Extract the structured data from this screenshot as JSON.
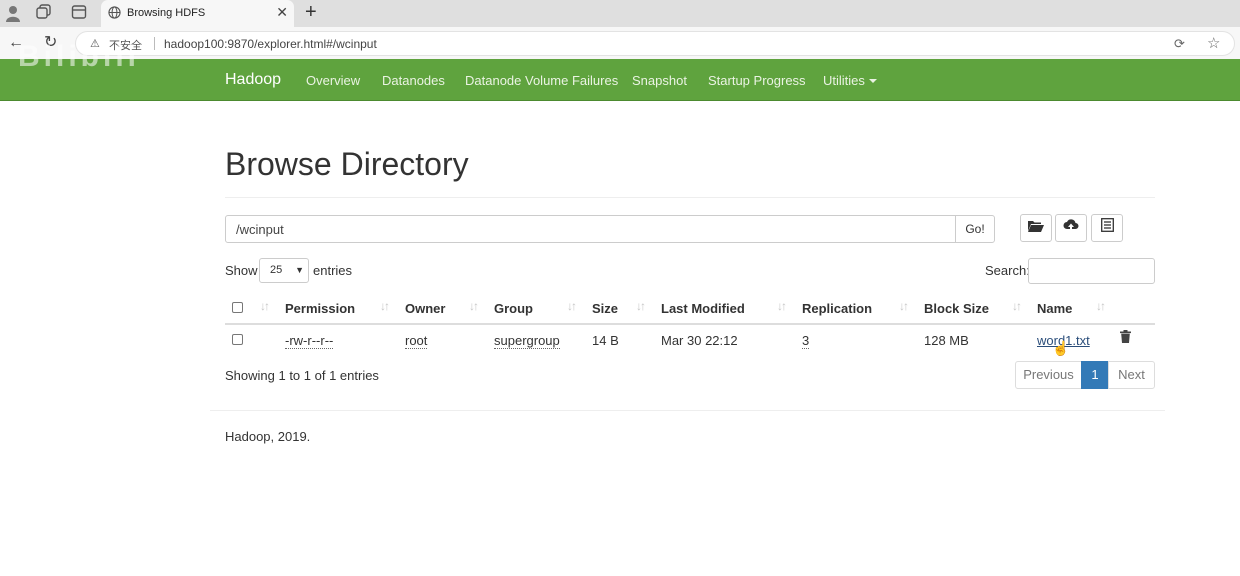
{
  "browser": {
    "tab_title": "Browsing HDFS",
    "url": "hadoop100:9870/explorer.html#/wcinput",
    "security_label": "不安全"
  },
  "watermark": "Bilibili",
  "navbar": {
    "brand": "Hadoop",
    "items": [
      "Overview",
      "Datanodes",
      "Datanode Volume Failures",
      "Snapshot",
      "Startup Progress",
      "Utilities"
    ]
  },
  "page": {
    "title": "Browse Directory",
    "path_value": "/wcinput",
    "go_label": "Go!",
    "show_label": "Show",
    "page_size": "25",
    "entries_label": "entries",
    "search_label": "Search:"
  },
  "table": {
    "columns": [
      "Permission",
      "Owner",
      "Group",
      "Size",
      "Last Modified",
      "Replication",
      "Block Size",
      "Name"
    ],
    "rows": [
      {
        "permission": "-rw-r--r--",
        "owner": "root",
        "group": "supergroup",
        "size": "14 B",
        "last_modified": "Mar 30 22:12",
        "replication": "3",
        "block_size": "128 MB",
        "name": "word1.txt"
      }
    ]
  },
  "pagination": {
    "info": "Showing 1 to 1 of 1 entries",
    "previous": "Previous",
    "current": "1",
    "next": "Next"
  },
  "footer": "Hadoop, 2019.",
  "colors": {
    "navbar": "#5fa33e",
    "pager_active": "#337ab7",
    "link": "#2a4d7a"
  }
}
